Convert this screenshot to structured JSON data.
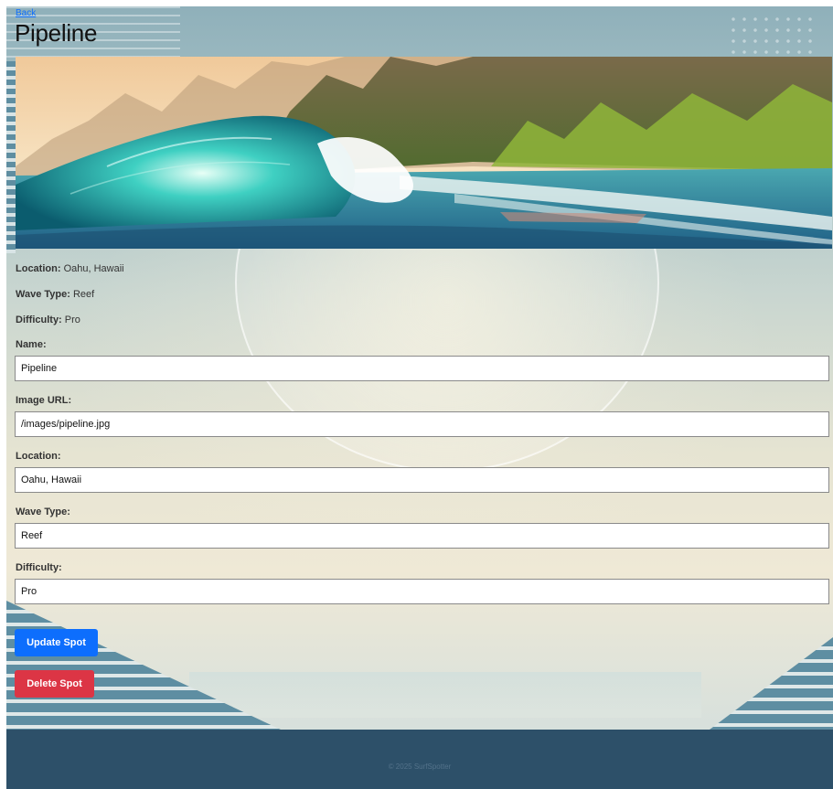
{
  "nav": {
    "back_label": "Back"
  },
  "page": {
    "title": "Pipeline"
  },
  "hero": {
    "icon": "wave-landscape-image"
  },
  "details": {
    "location_label": "Location:",
    "location_value": "Oahu, Hawaii",
    "wave_type_label": "Wave Type:",
    "wave_type_value": "Reef",
    "difficulty_label": "Difficulty:",
    "difficulty_value": "Pro"
  },
  "form": {
    "name": {
      "label": "Name:",
      "value": "Pipeline"
    },
    "image_url": {
      "label": "Image URL:",
      "value": "/images/pipeline.jpg"
    },
    "location": {
      "label": "Location:",
      "value": "Oahu, Hawaii"
    },
    "wave_type": {
      "label": "Wave Type:",
      "value": "Reef"
    },
    "difficulty": {
      "label": "Difficulty:",
      "value": "Pro"
    }
  },
  "actions": {
    "update_label": "Update Spot",
    "delete_label": "Delete Spot"
  },
  "footer": {
    "text": "© 2025 SurfSpotter"
  },
  "colors": {
    "primary": "#0d6efd",
    "danger": "#dc3545",
    "footer_bg": "#2d5069"
  }
}
